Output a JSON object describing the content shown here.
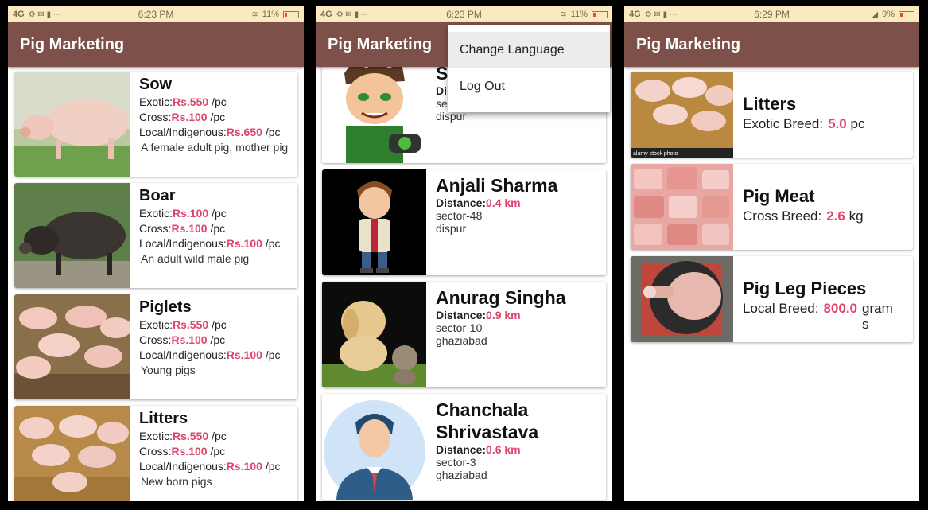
{
  "app_title": "Pig Marketing",
  "screen1": {
    "status": {
      "network": "4G",
      "time": "6:23 PM",
      "battery": "11%"
    },
    "products": [
      {
        "name": "Sow",
        "exotic_label": "Exotic:",
        "exotic_price": "Rs.550",
        "cross_label": "Cross:",
        "cross_price": "Rs.100",
        "local_label": "Local/Indigenous:",
        "local_price": "Rs.650",
        "unit": "/pc",
        "description": "A female adult pig, mother pig"
      },
      {
        "name": "Boar",
        "exotic_label": "Exotic:",
        "exotic_price": "Rs.100",
        "cross_label": "Cross:",
        "cross_price": "Rs.100",
        "local_label": "Local/Indigenous:",
        "local_price": "Rs.100",
        "unit": "/pc",
        "description": "An adult wild male pig"
      },
      {
        "name": "Piglets",
        "exotic_label": "Exotic:",
        "exotic_price": "Rs.550",
        "cross_label": "Cross:",
        "cross_price": "Rs.100",
        "local_label": "Local/Indigenous:",
        "local_price": "Rs.100",
        "unit": "/pc",
        "description": "Young pigs"
      },
      {
        "name": "Litters",
        "exotic_label": "Exotic:",
        "exotic_price": "Rs.550",
        "cross_label": "Cross:",
        "cross_price": "Rs.100",
        "local_label": "Local/Indigenous:",
        "local_price": "Rs.100",
        "unit": "/pc",
        "description": "New born pigs"
      }
    ]
  },
  "screen2": {
    "status": {
      "network": "4G",
      "time": "6:23 PM",
      "battery": "11%"
    },
    "menu": {
      "change_language": "Change Language",
      "log_out": "Log Out"
    },
    "users": [
      {
        "name": "S",
        "distance_label": "Di",
        "distance": "",
        "sector": "sector",
        "city": "dispur"
      },
      {
        "name": "Anjali Sharma",
        "distance_label": "Distance:",
        "distance": "0.4 km",
        "sector": "sector-48",
        "city": "dispur"
      },
      {
        "name": "Anurag Singha",
        "distance_label": "Distance:",
        "distance": "0.9 km",
        "sector": "sector-10",
        "city": "ghaziabad"
      },
      {
        "name": "Chanchala Shrivastava",
        "distance_label": "Distance:",
        "distance": "0.6 km",
        "sector": "sector-3",
        "city": "ghaziabad"
      }
    ]
  },
  "screen3": {
    "status": {
      "network": "4G",
      "time": "6:29 PM",
      "battery": "9%"
    },
    "listings": [
      {
        "name": "Litters",
        "breed": "Exotic Breed:",
        "quantity": "5.0",
        "unit": "pc",
        "photo_caption": "alamy stock photo"
      },
      {
        "name": "Pig Meat",
        "breed": "Cross Breed:",
        "quantity": "2.6",
        "unit": "kg"
      },
      {
        "name": "Pig Leg Pieces",
        "breed": "Local Breed:",
        "quantity": "800.0",
        "unit": "grams"
      }
    ]
  },
  "colors": {
    "appbar": "#7d5149",
    "price": "#e0436b",
    "statusbar": "#fbeac0"
  }
}
